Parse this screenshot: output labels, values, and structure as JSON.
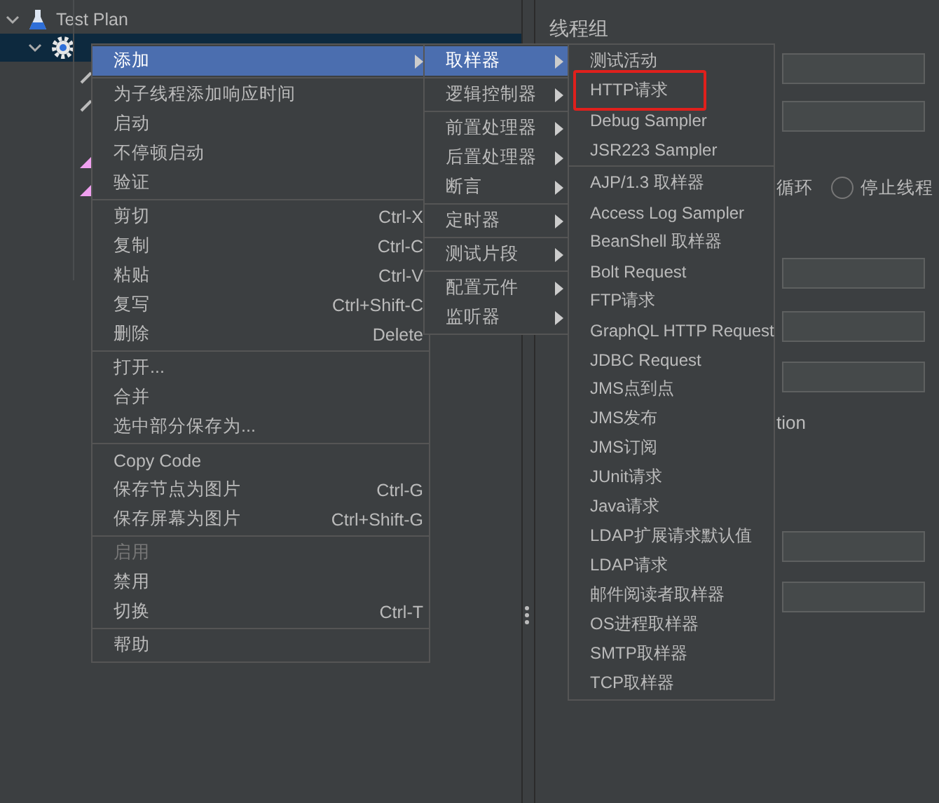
{
  "tree": [
    {
      "kind": "flask",
      "label": "Test Plan",
      "expanded": true,
      "selected": false
    },
    {
      "kind": "gear",
      "expanded": true,
      "selected": true
    }
  ],
  "panel": {
    "title": "线程组",
    "loop_label": "循环",
    "radio": {
      "label": "停止线程",
      "selected": false
    },
    "fragment": "tion"
  },
  "context_menu": {
    "items": [
      {
        "kind": "item",
        "label": "添加",
        "has_submenu": true,
        "selected": true,
        "disabled": false
      },
      {
        "kind": "separator"
      },
      {
        "kind": "item",
        "label": "为子线程添加响应时间",
        "selected": false,
        "disabled": false
      },
      {
        "kind": "item",
        "label": "启动",
        "selected": false,
        "disabled": false
      },
      {
        "kind": "item",
        "label": "不停顿启动",
        "selected": false,
        "disabled": false
      },
      {
        "kind": "item",
        "label": "验证",
        "selected": false,
        "disabled": false
      },
      {
        "kind": "separator"
      },
      {
        "kind": "item",
        "label": "剪切",
        "shortcut": "Ctrl-X",
        "selected": false,
        "disabled": false
      },
      {
        "kind": "item",
        "label": "复制",
        "shortcut": "Ctrl-C",
        "selected": false,
        "disabled": false
      },
      {
        "kind": "item",
        "label": "粘贴",
        "shortcut": "Ctrl-V",
        "selected": false,
        "disabled": false
      },
      {
        "kind": "item",
        "label": "复写",
        "shortcut": "Ctrl+Shift-C",
        "selected": false,
        "disabled": false
      },
      {
        "kind": "item",
        "label": "删除",
        "shortcut": "Delete",
        "selected": false,
        "disabled": false
      },
      {
        "kind": "separator"
      },
      {
        "kind": "item",
        "label": "打开...",
        "selected": false,
        "disabled": false
      },
      {
        "kind": "item",
        "label": "合并",
        "selected": false,
        "disabled": false
      },
      {
        "kind": "item",
        "label": "选中部分保存为...",
        "selected": false,
        "disabled": false
      },
      {
        "kind": "separator"
      },
      {
        "kind": "item",
        "label": "Copy Code",
        "selected": false,
        "disabled": false
      },
      {
        "kind": "item",
        "label": "保存节点为图片",
        "shortcut": "Ctrl-G",
        "selected": false,
        "disabled": false
      },
      {
        "kind": "item",
        "label": "保存屏幕为图片",
        "shortcut": "Ctrl+Shift-G",
        "selected": false,
        "disabled": false
      },
      {
        "kind": "separator"
      },
      {
        "kind": "item",
        "label": "启用",
        "selected": false,
        "disabled": true
      },
      {
        "kind": "item",
        "label": "禁用",
        "selected": false,
        "disabled": false
      },
      {
        "kind": "item",
        "label": "切换",
        "shortcut": "Ctrl-T",
        "selected": false,
        "disabled": false
      },
      {
        "kind": "separator"
      },
      {
        "kind": "item",
        "label": "帮助",
        "selected": false,
        "disabled": false
      }
    ]
  },
  "add_submenu": {
    "items": [
      {
        "kind": "item",
        "label": "取样器",
        "selected": true
      },
      {
        "kind": "separator"
      },
      {
        "kind": "item",
        "label": "逻辑控制器",
        "selected": false
      },
      {
        "kind": "separator"
      },
      {
        "kind": "item",
        "label": "前置处理器",
        "selected": false
      },
      {
        "kind": "item",
        "label": "后置处理器",
        "selected": false
      },
      {
        "kind": "item",
        "label": "断言",
        "selected": false
      },
      {
        "kind": "separator"
      },
      {
        "kind": "item",
        "label": "定时器",
        "selected": false
      },
      {
        "kind": "separator"
      },
      {
        "kind": "item",
        "label": "测试片段",
        "selected": false
      },
      {
        "kind": "separator"
      },
      {
        "kind": "item",
        "label": "配置元件",
        "selected": false
      },
      {
        "kind": "item",
        "label": "监听器",
        "selected": false
      }
    ]
  },
  "sampler_menu": {
    "items": [
      {
        "kind": "item",
        "label": "测试活动",
        "highlighted": false
      },
      {
        "kind": "item",
        "label": "HTTP请求",
        "highlighted": true
      },
      {
        "kind": "item",
        "label": "Debug Sampler",
        "highlighted": false
      },
      {
        "kind": "item",
        "label": "JSR223 Sampler",
        "highlighted": false
      },
      {
        "kind": "separator"
      },
      {
        "kind": "item",
        "label": "AJP/1.3 取样器",
        "highlighted": false
      },
      {
        "kind": "item",
        "label": "Access Log Sampler",
        "highlighted": false
      },
      {
        "kind": "item",
        "label": "BeanShell 取样器",
        "highlighted": false
      },
      {
        "kind": "item",
        "label": "Bolt Request",
        "highlighted": false
      },
      {
        "kind": "item",
        "label": "FTP请求",
        "highlighted": false
      },
      {
        "kind": "item",
        "label": "GraphQL HTTP Request",
        "highlighted": false
      },
      {
        "kind": "item",
        "label": "JDBC Request",
        "highlighted": false
      },
      {
        "kind": "item",
        "label": "JMS点到点",
        "highlighted": false
      },
      {
        "kind": "item",
        "label": "JMS发布",
        "highlighted": false
      },
      {
        "kind": "item",
        "label": "JMS订阅",
        "highlighted": false
      },
      {
        "kind": "item",
        "label": "JUnit请求",
        "highlighted": false
      },
      {
        "kind": "item",
        "label": "Java请求",
        "highlighted": false
      },
      {
        "kind": "item",
        "label": "LDAP扩展请求默认值",
        "highlighted": false
      },
      {
        "kind": "item",
        "label": "LDAP请求",
        "highlighted": false
      },
      {
        "kind": "item",
        "label": "邮件阅读者取样器",
        "highlighted": false
      },
      {
        "kind": "item",
        "label": "OS进程取样器",
        "highlighted": false
      },
      {
        "kind": "item",
        "label": "SMTP取样器",
        "highlighted": false
      },
      {
        "kind": "item",
        "label": "TCP取样器",
        "highlighted": false
      }
    ]
  }
}
